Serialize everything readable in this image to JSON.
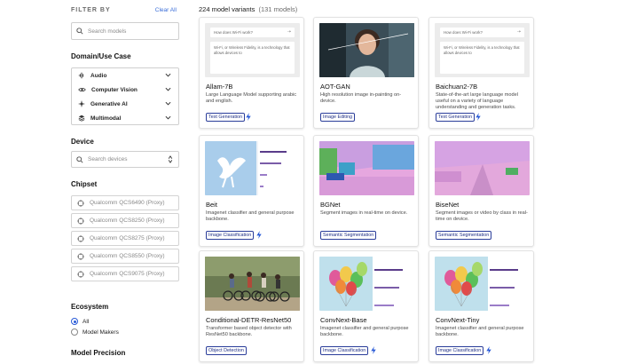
{
  "sidebar": {
    "filter_by": "FILTER BY",
    "clear_all": "Clear All",
    "search_placeholder": "Search models",
    "domain_title": "Domain/Use Case",
    "domains": [
      {
        "label": "Audio",
        "icon": "audio-wave-icon"
      },
      {
        "label": "Computer Vision",
        "icon": "eye-icon"
      },
      {
        "label": "Generative AI",
        "icon": "sparkle-icon"
      },
      {
        "label": "Multimodal",
        "icon": "layers-icon"
      }
    ],
    "device_title": "Device",
    "device_placeholder": "Search devices",
    "chipset_title": "Chipset",
    "chipsets": [
      "Qualcomm QCS6490 (Proxy)",
      "Qualcomm QCS8250 (Proxy)",
      "Qualcomm QCS8275 (Proxy)",
      "Qualcomm QCS8550 (Proxy)",
      "Qualcomm QCS9075 (Proxy)"
    ],
    "ecosystem_title": "Ecosystem",
    "ecosystem_options": [
      {
        "label": "All",
        "selected": true
      },
      {
        "label": "Model Makers",
        "selected": false
      }
    ],
    "precision_title": "Model Precision"
  },
  "results": {
    "count_main": "224 model variants",
    "count_sub": "(131 models)"
  },
  "llm_thumb": {
    "question": "How does Wi-Fi work?",
    "answer": "Wi-Fi, or Wireless Fidelity, is a technology that allows devices to"
  },
  "models": [
    {
      "name": "Allam-7B",
      "description": "Large Language Model supporting arabic and english.",
      "tag": "Text Generation"
    },
    {
      "name": "AOT-GAN",
      "description": "High resolution image in-painting on-device.",
      "tag": "Image Editing"
    },
    {
      "name": "Baichuan2-7B",
      "description": "State-of-the-art large language model useful on a variety of language understanding and generation tasks.",
      "tag": "Text Generation"
    },
    {
      "name": "Beit",
      "description": "Imagenet classifier and general purpose backbone.",
      "tag": "Image Classification"
    },
    {
      "name": "BGNet",
      "description": "Segment images in real-time on device.",
      "tag": "Semantic Segmentation"
    },
    {
      "name": "BiseNet",
      "description": "Segment images or video by class in real-time on device.",
      "tag": "Semantic Segmentation"
    },
    {
      "name": "Conditional-DETR-ResNet50",
      "description": "Transformer based object detector with ResNet50 backbone.",
      "tag": "Object Detection"
    },
    {
      "name": "ConvNext-Base",
      "description": "Imagenet classifier and general purpose backbone.",
      "tag": "Image Classification"
    },
    {
      "name": "ConvNext-Tiny",
      "description": "Imagenet classifier and general purpose backbone.",
      "tag": "Image Classification"
    }
  ],
  "colors": {
    "accent": "#3b6ed8",
    "tag_border": "#2a3d9a",
    "bolt": "#2a5bd7"
  }
}
